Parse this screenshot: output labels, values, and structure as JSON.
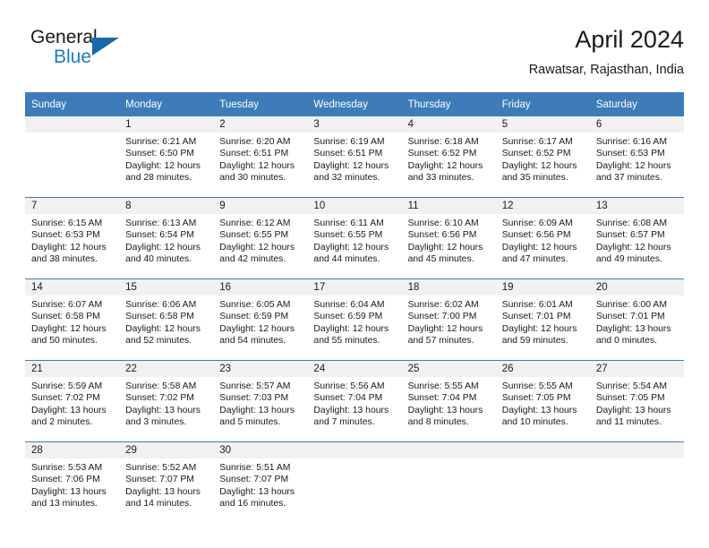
{
  "logo": {
    "word_one": "General",
    "word_two": "Blue",
    "triangle_color": "#1769aa",
    "blue_color": "#1f7ac4"
  },
  "header": {
    "title": "April 2024",
    "subtitle": "Rawatsar, Rajasthan, India"
  },
  "theme": {
    "header_blue": "#3d7cb8",
    "day_band_gray": "#f1f1f1",
    "text_color": "#1a1a1a"
  },
  "weekday_headers": [
    "Sunday",
    "Monday",
    "Tuesday",
    "Wednesday",
    "Thursday",
    "Friday",
    "Saturday"
  ],
  "weeks": [
    [
      {
        "day": "",
        "empty": true,
        "sunrise": "",
        "sunset": "",
        "daylight_line1": "",
        "daylight_line2": ""
      },
      {
        "day": "1",
        "sunrise": "Sunrise: 6:21 AM",
        "sunset": "Sunset: 6:50 PM",
        "daylight_line1": "Daylight: 12 hours",
        "daylight_line2": "and 28 minutes."
      },
      {
        "day": "2",
        "sunrise": "Sunrise: 6:20 AM",
        "sunset": "Sunset: 6:51 PM",
        "daylight_line1": "Daylight: 12 hours",
        "daylight_line2": "and 30 minutes."
      },
      {
        "day": "3",
        "sunrise": "Sunrise: 6:19 AM",
        "sunset": "Sunset: 6:51 PM",
        "daylight_line1": "Daylight: 12 hours",
        "daylight_line2": "and 32 minutes."
      },
      {
        "day": "4",
        "sunrise": "Sunrise: 6:18 AM",
        "sunset": "Sunset: 6:52 PM",
        "daylight_line1": "Daylight: 12 hours",
        "daylight_line2": "and 33 minutes."
      },
      {
        "day": "5",
        "sunrise": "Sunrise: 6:17 AM",
        "sunset": "Sunset: 6:52 PM",
        "daylight_line1": "Daylight: 12 hours",
        "daylight_line2": "and 35 minutes."
      },
      {
        "day": "6",
        "sunrise": "Sunrise: 6:16 AM",
        "sunset": "Sunset: 6:53 PM",
        "daylight_line1": "Daylight: 12 hours",
        "daylight_line2": "and 37 minutes."
      }
    ],
    [
      {
        "day": "7",
        "sunrise": "Sunrise: 6:15 AM",
        "sunset": "Sunset: 6:53 PM",
        "daylight_line1": "Daylight: 12 hours",
        "daylight_line2": "and 38 minutes."
      },
      {
        "day": "8",
        "sunrise": "Sunrise: 6:13 AM",
        "sunset": "Sunset: 6:54 PM",
        "daylight_line1": "Daylight: 12 hours",
        "daylight_line2": "and 40 minutes."
      },
      {
        "day": "9",
        "sunrise": "Sunrise: 6:12 AM",
        "sunset": "Sunset: 6:55 PM",
        "daylight_line1": "Daylight: 12 hours",
        "daylight_line2": "and 42 minutes."
      },
      {
        "day": "10",
        "sunrise": "Sunrise: 6:11 AM",
        "sunset": "Sunset: 6:55 PM",
        "daylight_line1": "Daylight: 12 hours",
        "daylight_line2": "and 44 minutes."
      },
      {
        "day": "11",
        "sunrise": "Sunrise: 6:10 AM",
        "sunset": "Sunset: 6:56 PM",
        "daylight_line1": "Daylight: 12 hours",
        "daylight_line2": "and 45 minutes."
      },
      {
        "day": "12",
        "sunrise": "Sunrise: 6:09 AM",
        "sunset": "Sunset: 6:56 PM",
        "daylight_line1": "Daylight: 12 hours",
        "daylight_line2": "and 47 minutes."
      },
      {
        "day": "13",
        "sunrise": "Sunrise: 6:08 AM",
        "sunset": "Sunset: 6:57 PM",
        "daylight_line1": "Daylight: 12 hours",
        "daylight_line2": "and 49 minutes."
      }
    ],
    [
      {
        "day": "14",
        "sunrise": "Sunrise: 6:07 AM",
        "sunset": "Sunset: 6:58 PM",
        "daylight_line1": "Daylight: 12 hours",
        "daylight_line2": "and 50 minutes."
      },
      {
        "day": "15",
        "sunrise": "Sunrise: 6:06 AM",
        "sunset": "Sunset: 6:58 PM",
        "daylight_line1": "Daylight: 12 hours",
        "daylight_line2": "and 52 minutes."
      },
      {
        "day": "16",
        "sunrise": "Sunrise: 6:05 AM",
        "sunset": "Sunset: 6:59 PM",
        "daylight_line1": "Daylight: 12 hours",
        "daylight_line2": "and 54 minutes."
      },
      {
        "day": "17",
        "sunrise": "Sunrise: 6:04 AM",
        "sunset": "Sunset: 6:59 PM",
        "daylight_line1": "Daylight: 12 hours",
        "daylight_line2": "and 55 minutes."
      },
      {
        "day": "18",
        "sunrise": "Sunrise: 6:02 AM",
        "sunset": "Sunset: 7:00 PM",
        "daylight_line1": "Daylight: 12 hours",
        "daylight_line2": "and 57 minutes."
      },
      {
        "day": "19",
        "sunrise": "Sunrise: 6:01 AM",
        "sunset": "Sunset: 7:01 PM",
        "daylight_line1": "Daylight: 12 hours",
        "daylight_line2": "and 59 minutes."
      },
      {
        "day": "20",
        "sunrise": "Sunrise: 6:00 AM",
        "sunset": "Sunset: 7:01 PM",
        "daylight_line1": "Daylight: 13 hours",
        "daylight_line2": "and 0 minutes."
      }
    ],
    [
      {
        "day": "21",
        "sunrise": "Sunrise: 5:59 AM",
        "sunset": "Sunset: 7:02 PM",
        "daylight_line1": "Daylight: 13 hours",
        "daylight_line2": "and 2 minutes."
      },
      {
        "day": "22",
        "sunrise": "Sunrise: 5:58 AM",
        "sunset": "Sunset: 7:02 PM",
        "daylight_line1": "Daylight: 13 hours",
        "daylight_line2": "and 3 minutes."
      },
      {
        "day": "23",
        "sunrise": "Sunrise: 5:57 AM",
        "sunset": "Sunset: 7:03 PM",
        "daylight_line1": "Daylight: 13 hours",
        "daylight_line2": "and 5 minutes."
      },
      {
        "day": "24",
        "sunrise": "Sunrise: 5:56 AM",
        "sunset": "Sunset: 7:04 PM",
        "daylight_line1": "Daylight: 13 hours",
        "daylight_line2": "and 7 minutes."
      },
      {
        "day": "25",
        "sunrise": "Sunrise: 5:55 AM",
        "sunset": "Sunset: 7:04 PM",
        "daylight_line1": "Daylight: 13 hours",
        "daylight_line2": "and 8 minutes."
      },
      {
        "day": "26",
        "sunrise": "Sunrise: 5:55 AM",
        "sunset": "Sunset: 7:05 PM",
        "daylight_line1": "Daylight: 13 hours",
        "daylight_line2": "and 10 minutes."
      },
      {
        "day": "27",
        "sunrise": "Sunrise: 5:54 AM",
        "sunset": "Sunset: 7:05 PM",
        "daylight_line1": "Daylight: 13 hours",
        "daylight_line2": "and 11 minutes."
      }
    ],
    [
      {
        "day": "28",
        "sunrise": "Sunrise: 5:53 AM",
        "sunset": "Sunset: 7:06 PM",
        "daylight_line1": "Daylight: 13 hours",
        "daylight_line2": "and 13 minutes."
      },
      {
        "day": "29",
        "sunrise": "Sunrise: 5:52 AM",
        "sunset": "Sunset: 7:07 PM",
        "daylight_line1": "Daylight: 13 hours",
        "daylight_line2": "and 14 minutes."
      },
      {
        "day": "30",
        "sunrise": "Sunrise: 5:51 AM",
        "sunset": "Sunset: 7:07 PM",
        "daylight_line1": "Daylight: 13 hours",
        "daylight_line2": "and 16 minutes."
      },
      {
        "day": "",
        "empty": true,
        "sunrise": "",
        "sunset": "",
        "daylight_line1": "",
        "daylight_line2": ""
      },
      {
        "day": "",
        "empty": true,
        "sunrise": "",
        "sunset": "",
        "daylight_line1": "",
        "daylight_line2": ""
      },
      {
        "day": "",
        "empty": true,
        "sunrise": "",
        "sunset": "",
        "daylight_line1": "",
        "daylight_line2": ""
      },
      {
        "day": "",
        "empty": true,
        "sunrise": "",
        "sunset": "",
        "daylight_line1": "",
        "daylight_line2": ""
      }
    ]
  ]
}
